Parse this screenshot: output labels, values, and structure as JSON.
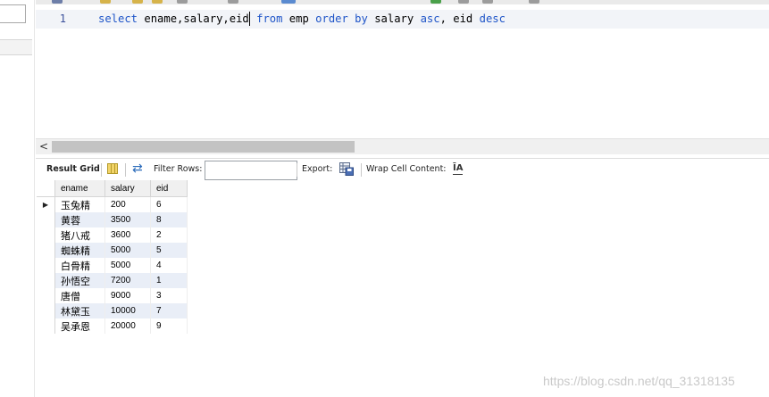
{
  "editor": {
    "line_number": "1",
    "sql_tokens": [
      {
        "text": "select",
        "kw": true
      },
      {
        "text": " ename,salary,eid",
        "kw": false
      },
      {
        "text": " from",
        "kw": true
      },
      {
        "text": " emp ",
        "kw": false
      },
      {
        "text": "order by",
        "kw": true
      },
      {
        "text": " salary ",
        "kw": false
      },
      {
        "text": "asc",
        "kw": true
      },
      {
        "text": ", eid ",
        "kw": false
      },
      {
        "text": "desc",
        "kw": true
      }
    ]
  },
  "result_toolbar": {
    "result_grid_label": "Result Grid",
    "filter_rows_label": "Filter Rows:",
    "filter_value": "",
    "export_label": "Export:",
    "wrap_label": "Wrap Cell Content:",
    "wrap_icon_glyph": "ĪA"
  },
  "grid": {
    "columns": [
      "ename",
      "salary",
      "eid"
    ],
    "rows": [
      [
        "玉兔精",
        "200",
        "6"
      ],
      [
        "黄蓉",
        "3500",
        "8"
      ],
      [
        "猪八戒",
        "3600",
        "2"
      ],
      [
        "蜘蛛精",
        "5000",
        "5"
      ],
      [
        "白骨精",
        "5000",
        "4"
      ],
      [
        "孙悟空",
        "7200",
        "1"
      ],
      [
        "唐僧",
        "9000",
        "3"
      ],
      [
        "林黛玉",
        "10000",
        "7"
      ],
      [
        "吴承恩",
        "20000",
        "9"
      ]
    ],
    "current_row_marker": "▶"
  },
  "watermark": "https://blog.csdn.net/qq_31318135",
  "colors": {
    "keyword": "#1f55c8",
    "alt_row": "#e9eef7",
    "line_highlight": "#f2f4f8"
  },
  "icons": {
    "scroll_left": "<",
    "refresh": "⇄"
  }
}
